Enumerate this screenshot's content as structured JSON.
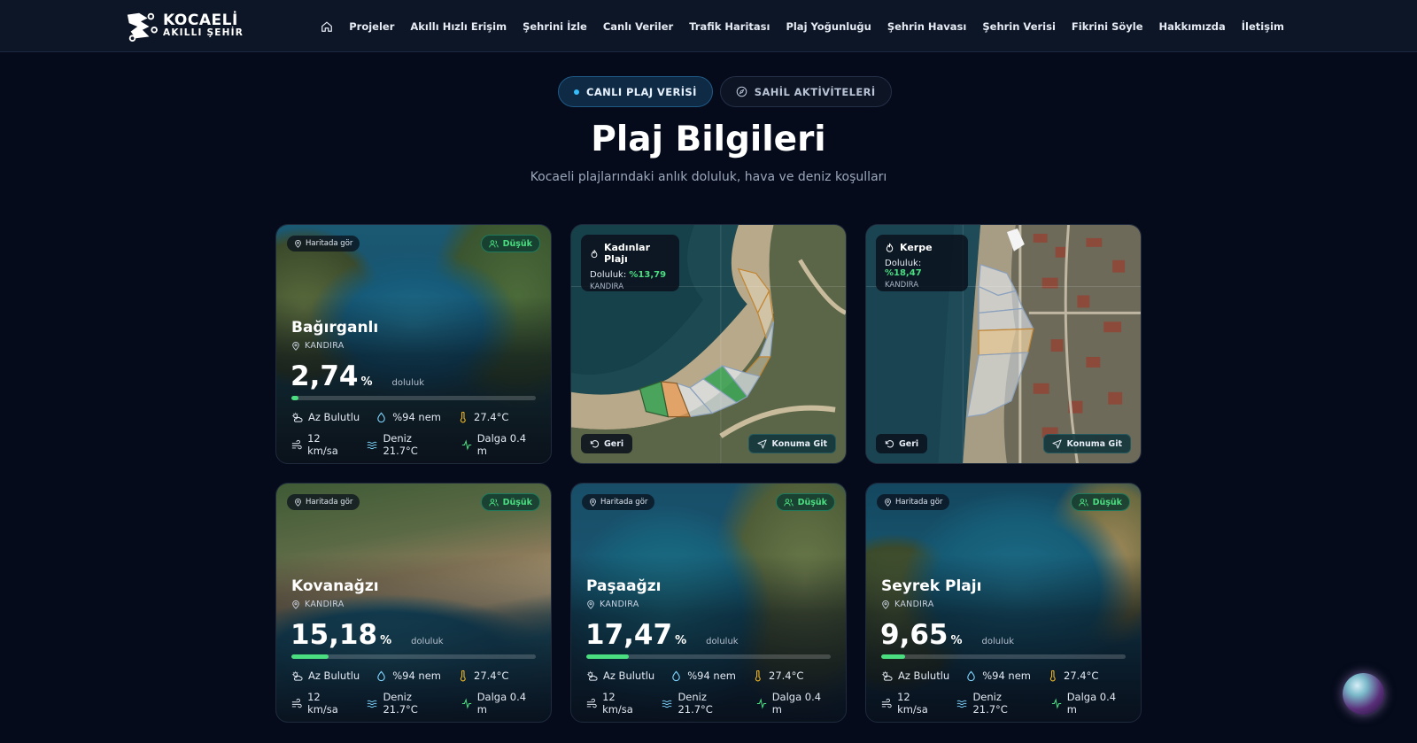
{
  "brand": {
    "line1": "KOCAELİ",
    "line2": "AKILLI ŞEHİR"
  },
  "nav": {
    "items": [
      "Projeler",
      "Akıllı Hızlı Erişim",
      "Şehrini İzle",
      "Canlı Veriler",
      "Trafik Haritası",
      "Plaj Yoğunluğu",
      "Şehrin Havası",
      "Şehrin Verisi",
      "Fikrini Söyle",
      "Hakkımızda",
      "İletişim"
    ]
  },
  "tabs": {
    "live": "CANLI PLAJ VERİSİ",
    "activities": "SAHİL AKTİVİTELERİ"
  },
  "header": {
    "title": "Plaj Bilgileri",
    "subtitle": "Kocaeli plajlarındaki anlık doluluk, hava ve deniz koşulları"
  },
  "common": {
    "map_chip": "Haritada gör",
    "occupancy_label": "doluluk",
    "percent_sign": "%",
    "back": "Geri",
    "go": "Konuma Git",
    "doluluk_prefix": "Doluluk: "
  },
  "cards": [
    {
      "name": "Bağırganlı",
      "district": "KANDIRA",
      "percent": "2,74",
      "level": 0.0274,
      "badge": "Düşük",
      "weather": "Az Bulutlu",
      "humidity": "%94 nem",
      "temp": "27.4°C",
      "wind": "12 km/sa",
      "sea": "Deniz 21.7°C",
      "wave": "Dalga 0.4 m"
    },
    {
      "name": "Kovanağzı",
      "district": "KANDIRA",
      "percent": "15,18",
      "level": 0.1518,
      "badge": "Düşük",
      "weather": "Az Bulutlu",
      "humidity": "%94 nem",
      "temp": "27.4°C",
      "wind": "12 km/sa",
      "sea": "Deniz 21.7°C",
      "wave": "Dalga 0.4 m"
    },
    {
      "name": "Paşaağzı",
      "district": "KANDIRA",
      "percent": "17,47",
      "level": 0.1747,
      "badge": "Düşük",
      "weather": "Az Bulutlu",
      "humidity": "%94 nem",
      "temp": "27.4°C",
      "wind": "12 km/sa",
      "sea": "Deniz 21.7°C",
      "wave": "Dalga 0.4 m"
    },
    {
      "name": "Seyrek Plajı",
      "district": "KANDIRA",
      "percent": "9,65",
      "level": 0.0965,
      "badge": "Düşük",
      "weather": "Az Bulutlu",
      "humidity": "%94 nem",
      "temp": "27.4°C",
      "wind": "12 km/sa",
      "sea": "Deniz 21.7°C",
      "wave": "Dalga 0.4 m"
    }
  ],
  "map_cards": [
    {
      "name": "Kadınlar Plajı",
      "value": "%13,79",
      "district": "KANDIRA"
    },
    {
      "name": "Kerpe",
      "value": "%18,47",
      "district": "KANDIRA"
    }
  ],
  "colors": {
    "accent": "#4ade80",
    "bg": "#050b1a",
    "nav": "#0d1626"
  }
}
